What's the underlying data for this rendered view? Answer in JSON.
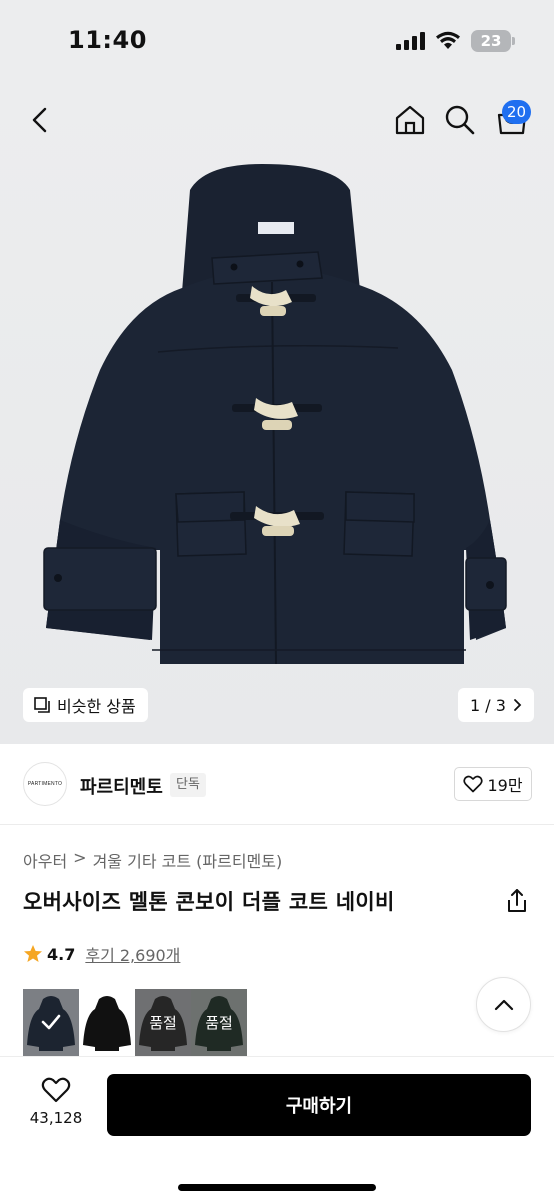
{
  "status": {
    "time": "11:40",
    "battery": "23"
  },
  "header": {
    "cart_count": "20"
  },
  "gallery": {
    "similar_label": "비슷한 상품",
    "page_indicator": "1 / 3"
  },
  "brand": {
    "logo_text": "PARTIMENTO",
    "name": "파르티멘토",
    "tag": "단독",
    "likes": "19만"
  },
  "breadcrumb": {
    "category": "아우터",
    "separator": ">",
    "subcategory": "겨울 기타 코트 (파르티멘토)"
  },
  "product": {
    "title": "오버사이즈 멜톤 콘보이 더플 코트 네이비",
    "rating": "4.7",
    "review_label": "후기 2,690개"
  },
  "options": [
    {
      "name": "navy",
      "label": "",
      "selected": true,
      "color": "#1c2430"
    },
    {
      "name": "black",
      "label": "",
      "selected": false,
      "color": "#111111"
    },
    {
      "name": "charcoal",
      "label": "품절",
      "selected": false,
      "color": "#262626"
    },
    {
      "name": "green",
      "label": "품절",
      "selected": false,
      "color": "#1f2a24"
    }
  ],
  "bottom": {
    "wish_count": "43,128",
    "buy_label": "구매하기"
  },
  "colors": {
    "accent": "#1f6ff0",
    "star": "#f5a623",
    "buy_button": "#000000",
    "coat": "#1c2535"
  }
}
